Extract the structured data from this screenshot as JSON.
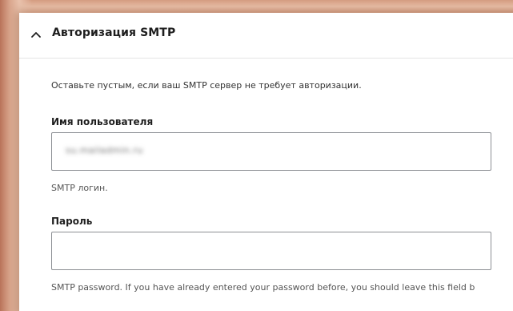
{
  "smtp_auth": {
    "title": "Авторизация SMTP",
    "expanded": true,
    "description": "Оставьте пустым, если ваш SMTP сервер не требует авторизации.",
    "username": {
      "label": "Имя пользователя",
      "value": "su.mailadmin.ru",
      "placeholder": "",
      "help": "SMTP логин."
    },
    "password": {
      "label": "Пароль",
      "value": "",
      "placeholder": "",
      "help": "SMTP password. If you have already entered your password before, you should leave this field b"
    }
  },
  "icons": {
    "toggle": "chevron-up-icon"
  }
}
